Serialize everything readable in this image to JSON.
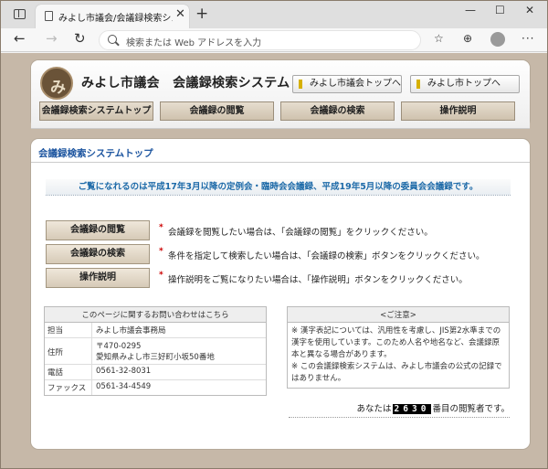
{
  "browser": {
    "tab_title": "みよし市議会/会議録検索システム",
    "tab_close": "✕",
    "new_tab": "+",
    "address_placeholder": "検索または Web アドレスを入力",
    "win_min": "—",
    "win_max": "☐",
    "win_close": "✕"
  },
  "header": {
    "site_title": "みよし市議会　会議録検索システム",
    "logo_mark": "み",
    "link_council": "みよし市議会トップへ",
    "link_city": "みよし市トップへ"
  },
  "menu": [
    {
      "label": "会議録検索システムトップ"
    },
    {
      "label": "会議録の閲覧"
    },
    {
      "label": "会議録の検索"
    },
    {
      "label": "操作説明"
    }
  ],
  "content": {
    "title": "会議録検索システムトップ",
    "banner": "ご覧になれるのは平成17年3月以降の定例会・臨時会会議録、平成19年5月以降の委員会会議録です。",
    "actions": [
      {
        "button": "会議録の閲覧",
        "desc": "会議録を閲覧したい場合は、「会議録の閲覧」をクリックください。"
      },
      {
        "button": "会議録の検索",
        "desc": "条件を指定して検索したい場合は、「会議録の検索」ボタンをクリックください。"
      },
      {
        "button": "操作説明",
        "desc": "操作説明をご覧になりたい場合は、「操作説明」ボタンをクリックください。"
      }
    ],
    "bullet": "*"
  },
  "contact": {
    "heading": "このページに関するお問い合わせはこちら",
    "rows": [
      {
        "key": "担当",
        "value": "みよし市議会事務局",
        "value2": ""
      },
      {
        "key": "住所",
        "value": "〒470-0295",
        "value2": "愛知県みよし市三好町小坂50番地"
      },
      {
        "key": "電話",
        "value": "0561-32-8031",
        "value2": ""
      },
      {
        "key": "ファックス",
        "value": "0561-34-4549",
        "value2": ""
      }
    ]
  },
  "notice": {
    "heading": "<ご注意>",
    "line1": "※ 漢字表記については、汎用性を考慮し、JIS第2水準までの漢字を使用しています。このため人名や地名など、会議録原本と異なる場合があります。",
    "line2": "※ この会議録検索システムは、みよし市議会の公式の記録ではありません。"
  },
  "counter": {
    "prefix": "あなたは",
    "number": "2630",
    "suffix": "番目の閲覧者です。"
  }
}
